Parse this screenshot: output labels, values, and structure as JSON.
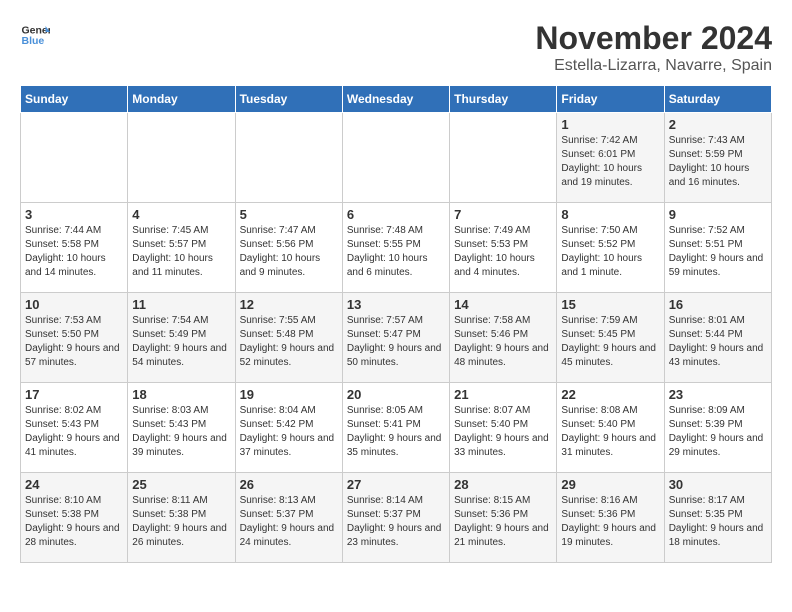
{
  "header": {
    "logo_line1": "General",
    "logo_line2": "Blue",
    "title": "November 2024",
    "subtitle": "Estella-Lizarra, Navarre, Spain"
  },
  "weekdays": [
    "Sunday",
    "Monday",
    "Tuesday",
    "Wednesday",
    "Thursday",
    "Friday",
    "Saturday"
  ],
  "weeks": [
    [
      {
        "day": "",
        "info": ""
      },
      {
        "day": "",
        "info": ""
      },
      {
        "day": "",
        "info": ""
      },
      {
        "day": "",
        "info": ""
      },
      {
        "day": "",
        "info": ""
      },
      {
        "day": "1",
        "info": "Sunrise: 7:42 AM\nSunset: 6:01 PM\nDaylight: 10 hours and 19 minutes."
      },
      {
        "day": "2",
        "info": "Sunrise: 7:43 AM\nSunset: 5:59 PM\nDaylight: 10 hours and 16 minutes."
      }
    ],
    [
      {
        "day": "3",
        "info": "Sunrise: 7:44 AM\nSunset: 5:58 PM\nDaylight: 10 hours and 14 minutes."
      },
      {
        "day": "4",
        "info": "Sunrise: 7:45 AM\nSunset: 5:57 PM\nDaylight: 10 hours and 11 minutes."
      },
      {
        "day": "5",
        "info": "Sunrise: 7:47 AM\nSunset: 5:56 PM\nDaylight: 10 hours and 9 minutes."
      },
      {
        "day": "6",
        "info": "Sunrise: 7:48 AM\nSunset: 5:55 PM\nDaylight: 10 hours and 6 minutes."
      },
      {
        "day": "7",
        "info": "Sunrise: 7:49 AM\nSunset: 5:53 PM\nDaylight: 10 hours and 4 minutes."
      },
      {
        "day": "8",
        "info": "Sunrise: 7:50 AM\nSunset: 5:52 PM\nDaylight: 10 hours and 1 minute."
      },
      {
        "day": "9",
        "info": "Sunrise: 7:52 AM\nSunset: 5:51 PM\nDaylight: 9 hours and 59 minutes."
      }
    ],
    [
      {
        "day": "10",
        "info": "Sunrise: 7:53 AM\nSunset: 5:50 PM\nDaylight: 9 hours and 57 minutes."
      },
      {
        "day": "11",
        "info": "Sunrise: 7:54 AM\nSunset: 5:49 PM\nDaylight: 9 hours and 54 minutes."
      },
      {
        "day": "12",
        "info": "Sunrise: 7:55 AM\nSunset: 5:48 PM\nDaylight: 9 hours and 52 minutes."
      },
      {
        "day": "13",
        "info": "Sunrise: 7:57 AM\nSunset: 5:47 PM\nDaylight: 9 hours and 50 minutes."
      },
      {
        "day": "14",
        "info": "Sunrise: 7:58 AM\nSunset: 5:46 PM\nDaylight: 9 hours and 48 minutes."
      },
      {
        "day": "15",
        "info": "Sunrise: 7:59 AM\nSunset: 5:45 PM\nDaylight: 9 hours and 45 minutes."
      },
      {
        "day": "16",
        "info": "Sunrise: 8:01 AM\nSunset: 5:44 PM\nDaylight: 9 hours and 43 minutes."
      }
    ],
    [
      {
        "day": "17",
        "info": "Sunrise: 8:02 AM\nSunset: 5:43 PM\nDaylight: 9 hours and 41 minutes."
      },
      {
        "day": "18",
        "info": "Sunrise: 8:03 AM\nSunset: 5:43 PM\nDaylight: 9 hours and 39 minutes."
      },
      {
        "day": "19",
        "info": "Sunrise: 8:04 AM\nSunset: 5:42 PM\nDaylight: 9 hours and 37 minutes."
      },
      {
        "day": "20",
        "info": "Sunrise: 8:05 AM\nSunset: 5:41 PM\nDaylight: 9 hours and 35 minutes."
      },
      {
        "day": "21",
        "info": "Sunrise: 8:07 AM\nSunset: 5:40 PM\nDaylight: 9 hours and 33 minutes."
      },
      {
        "day": "22",
        "info": "Sunrise: 8:08 AM\nSunset: 5:40 PM\nDaylight: 9 hours and 31 minutes."
      },
      {
        "day": "23",
        "info": "Sunrise: 8:09 AM\nSunset: 5:39 PM\nDaylight: 9 hours and 29 minutes."
      }
    ],
    [
      {
        "day": "24",
        "info": "Sunrise: 8:10 AM\nSunset: 5:38 PM\nDaylight: 9 hours and 28 minutes."
      },
      {
        "day": "25",
        "info": "Sunrise: 8:11 AM\nSunset: 5:38 PM\nDaylight: 9 hours and 26 minutes."
      },
      {
        "day": "26",
        "info": "Sunrise: 8:13 AM\nSunset: 5:37 PM\nDaylight: 9 hours and 24 minutes."
      },
      {
        "day": "27",
        "info": "Sunrise: 8:14 AM\nSunset: 5:37 PM\nDaylight: 9 hours and 23 minutes."
      },
      {
        "day": "28",
        "info": "Sunrise: 8:15 AM\nSunset: 5:36 PM\nDaylight: 9 hours and 21 minutes."
      },
      {
        "day": "29",
        "info": "Sunrise: 8:16 AM\nSunset: 5:36 PM\nDaylight: 9 hours and 19 minutes."
      },
      {
        "day": "30",
        "info": "Sunrise: 8:17 AM\nSunset: 5:35 PM\nDaylight: 9 hours and 18 minutes."
      }
    ]
  ]
}
